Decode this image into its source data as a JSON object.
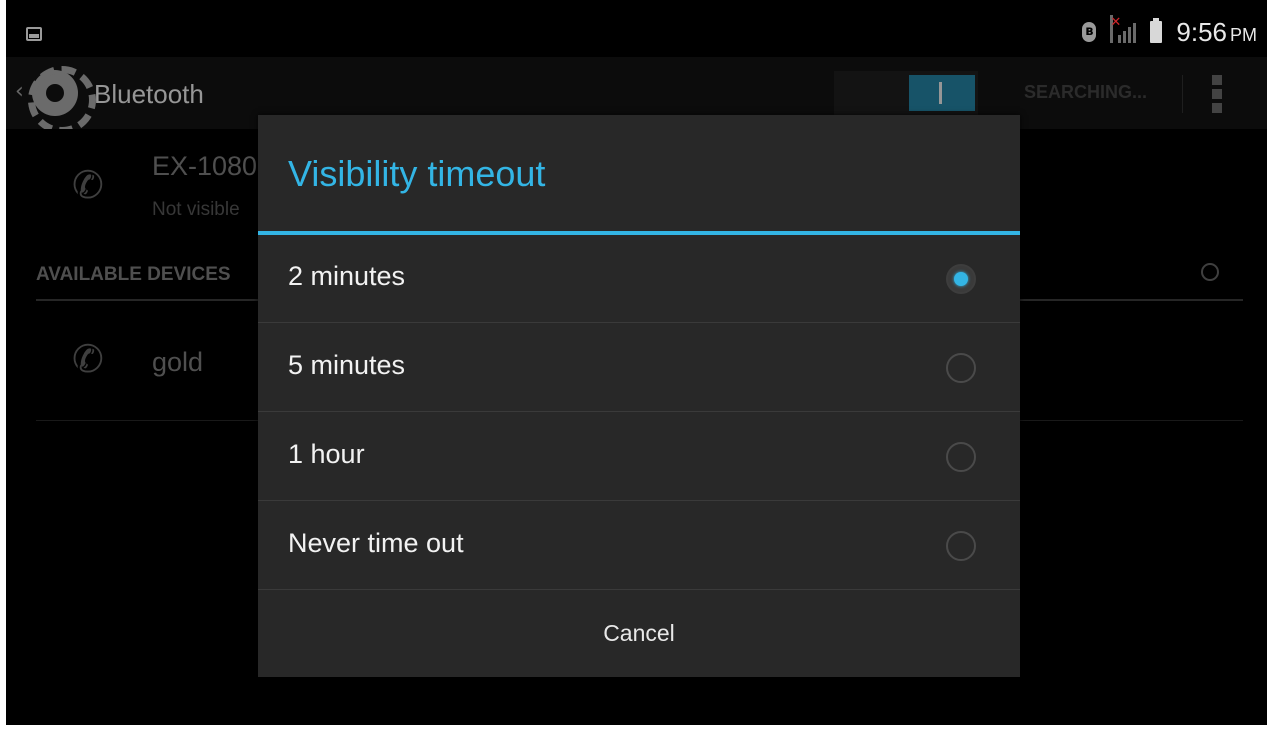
{
  "status_bar": {
    "time": "9:56",
    "ampm": "PM",
    "icons": [
      "gallery-notification-icon",
      "bluetooth-icon",
      "signal-no-sim-icon",
      "battery-icon"
    ]
  },
  "action_bar": {
    "title": "Bluetooth",
    "searching_label": "SEARCHING...",
    "bluetooth_on": true
  },
  "background": {
    "this_device": {
      "name": "EX-1080",
      "subtitle": "Not visible"
    },
    "available_header": "AVAILABLE DEVICES",
    "devices": [
      {
        "name": "gold"
      }
    ]
  },
  "dialog": {
    "title": "Visibility timeout",
    "options": [
      {
        "label": "2 minutes",
        "selected": true
      },
      {
        "label": "5 minutes",
        "selected": false
      },
      {
        "label": "1 hour",
        "selected": false
      },
      {
        "label": "Never time out",
        "selected": false
      }
    ],
    "cancel_label": "Cancel"
  },
  "colors": {
    "accent": "#33b5e5",
    "dialog_bg": "#282828",
    "background": "#000000"
  }
}
